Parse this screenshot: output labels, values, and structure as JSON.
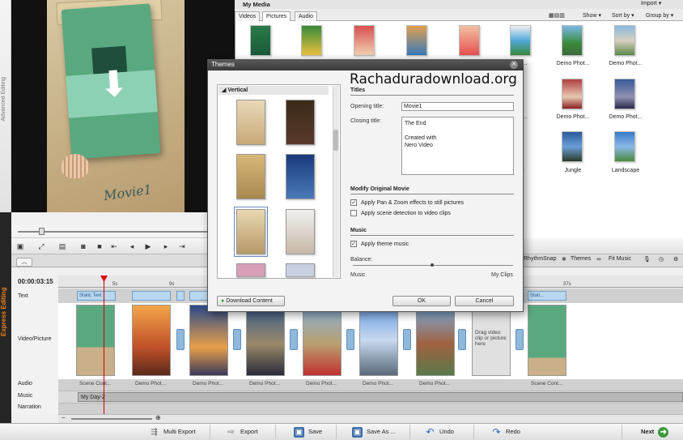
{
  "sidebar": {
    "advanced_editing": "Advanced Editing",
    "express_editing": "Express Editing"
  },
  "preview": {
    "movie_title": "Movie1"
  },
  "controls": {
    "rhythm_snap": "RhythmSnap",
    "themes": "Themes",
    "fit_music": "Fit Music"
  },
  "timeline": {
    "timecode": "00:00:03:15",
    "ruler": [
      "5s",
      "9s",
      "37s"
    ],
    "tracks": {
      "text": "Text",
      "video": "Video/Picture",
      "audio": "Audio",
      "music": "Music",
      "narration": "Narration"
    },
    "text_clips": [
      "Static Text",
      "Stati..."
    ],
    "captions": [
      "Scene Cont...",
      "Demo Phot...",
      "Demo Phot...",
      "Demo Phot...",
      "Demo Phot...",
      "Demo Phot...",
      "Demo Phot...",
      "Scene Cont..."
    ],
    "drag_hint": "Drag video clip or picture here",
    "music_clip": "My Day-2"
  },
  "bottom": {
    "multi_export": "Multi Export",
    "export": "Export",
    "save": "Save",
    "save_as": "Save As ...",
    "undo": "Undo",
    "redo": "Redo",
    "next": "Next"
  },
  "media": {
    "title": "My Media",
    "import": "Import",
    "tabs": [
      "Videos",
      "Pictures",
      "Audio"
    ],
    "show": "Show",
    "sort_by": "Sort by",
    "group_by": "Group by",
    "captions": [
      "hot...",
      "Demo Phot...",
      "Demo Phot...",
      "hot...",
      "Demo Phot...",
      "Demo Phot...",
      "se",
      "Jungle",
      "Landscape"
    ]
  },
  "dialog": {
    "title": "Themes",
    "category": "Vertical",
    "watermark": "Rachaduradownload.org",
    "titles_section": "Titles",
    "opening_label": "Opening title:",
    "opening_value": "Movie1",
    "closing_label": "Closing title:",
    "closing_value": "The End\n\nCreated with\nNero Video",
    "modify_section": "Modify Original Movie",
    "opt_panzoom": "Apply Pan & Zoom effects to still pictures",
    "opt_scene": "Apply scene detection to video clips",
    "music_section": "Music",
    "opt_theme_music": "Apply theme music",
    "balance_label": "Balance:",
    "balance_left": "Music",
    "balance_right": "My Clips",
    "download": "Download Content",
    "ok": "OK",
    "cancel": "Cancel"
  }
}
